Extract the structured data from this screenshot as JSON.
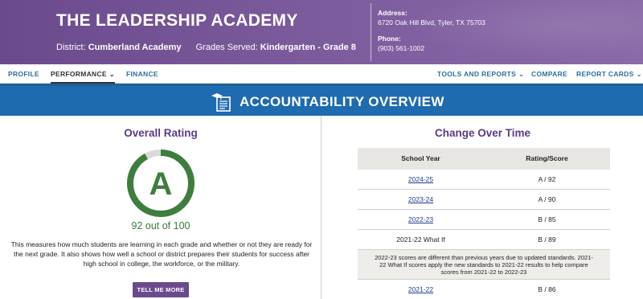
{
  "header": {
    "school_name": "THE LEADERSHIP ACADEMY",
    "district_label": "District:",
    "district_value": "Cumberland Academy",
    "grades_label": "Grades Served:",
    "grades_value": "Kindergarten - Grade 8",
    "address_label": "Address:",
    "address_value": "6720 Oak Hill Blvd, Tyler, TX 75703",
    "phone_label": "Phone:",
    "phone_value": "(903) 561-1002"
  },
  "nav": {
    "profile": "PROFILE",
    "performance": "PERFORMANCE",
    "finance": "FINANCE",
    "tools": "TOOLS AND REPORTS",
    "compare": "COMPARE",
    "report_cards": "REPORT CARDS",
    "chevron": "⌄"
  },
  "banner": {
    "title": "ACCOUNTABILITY OVERVIEW",
    "icon": "graduation-cap-document-icon"
  },
  "overall": {
    "title": "Overall Rating",
    "grade": "A",
    "score": 92,
    "score_max": 100,
    "score_text": "92 out of 100",
    "description": "This measures how much students are learning in each grade and whether or not they are ready for the next grade. It also shows how well a school or district prepares their students for success after high school in college, the workforce, or the military.",
    "button_label": "TELL ME MORE",
    "colors": {
      "ring": "#3f7d3f",
      "ring_track": "#d9d9d9",
      "button": "#6a4a8c"
    }
  },
  "change": {
    "title": "Change Over Time",
    "col_year": "School Year",
    "col_rating": "Rating/Score",
    "rows": [
      {
        "year": "2024-25",
        "rating": "A / 92",
        "link": true
      },
      {
        "year": "2023-24",
        "rating": "A / 90",
        "link": true
      },
      {
        "year": "2022-23",
        "rating": "B / 85",
        "link": true
      },
      {
        "year": "2021-22 What If",
        "rating": "B / 89",
        "link": false
      }
    ],
    "note": "2022-23 scores are different than previous years due to updated standards. 2021-22 What If scores apply the new standards to 2021-22 results to help compare scores from 2021-22 to 2022-23",
    "last_row": {
      "year": "2021-22",
      "rating": "B / 86",
      "link": true
    }
  }
}
